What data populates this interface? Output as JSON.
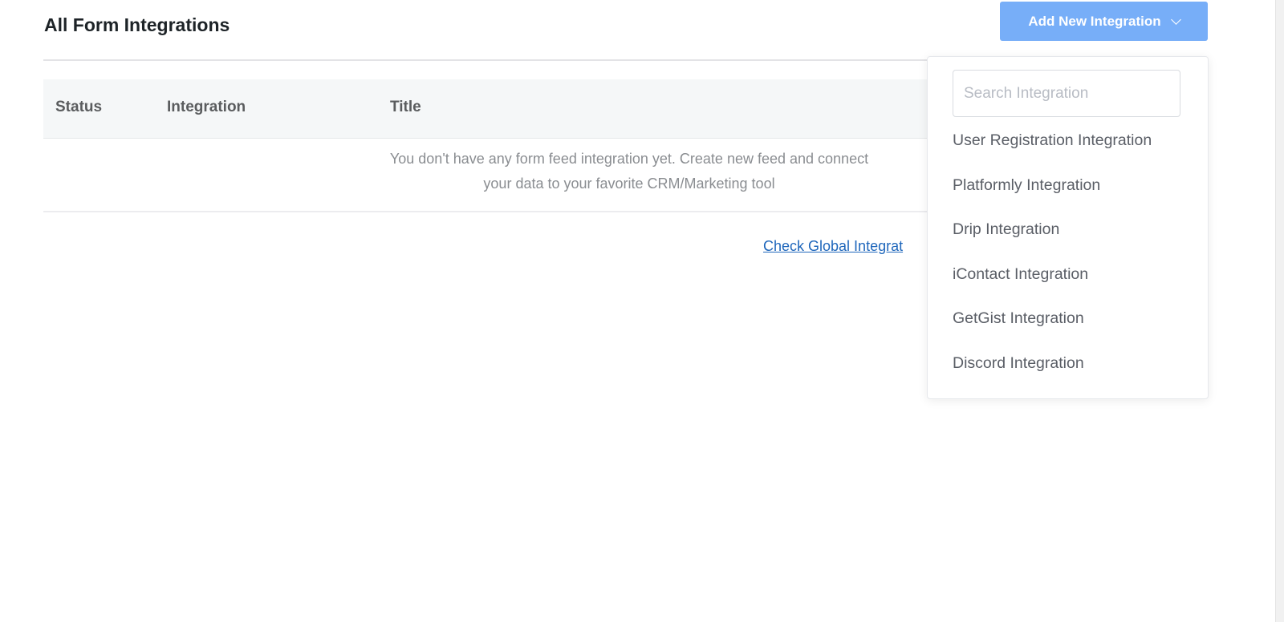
{
  "header": {
    "title": "All Form Integrations",
    "add_button_label": "Add New Integration"
  },
  "table": {
    "columns": [
      "Status",
      "Integration",
      "Title"
    ],
    "empty_message_line1": "You don't have any form feed integration yet. Create new feed and connect",
    "empty_message_line2": "your data to your favorite CRM/Marketing tool"
  },
  "global_link": "Check Global Integrat",
  "dropdown": {
    "search_placeholder": "Search Integration",
    "items": [
      "User Registration Integration",
      "Platformly Integration",
      "Drip Integration",
      "iContact Integration",
      "GetGist Integration",
      "Discord Integration"
    ]
  },
  "colors": {
    "button": "#77aef8",
    "link": "#1e66bb"
  }
}
